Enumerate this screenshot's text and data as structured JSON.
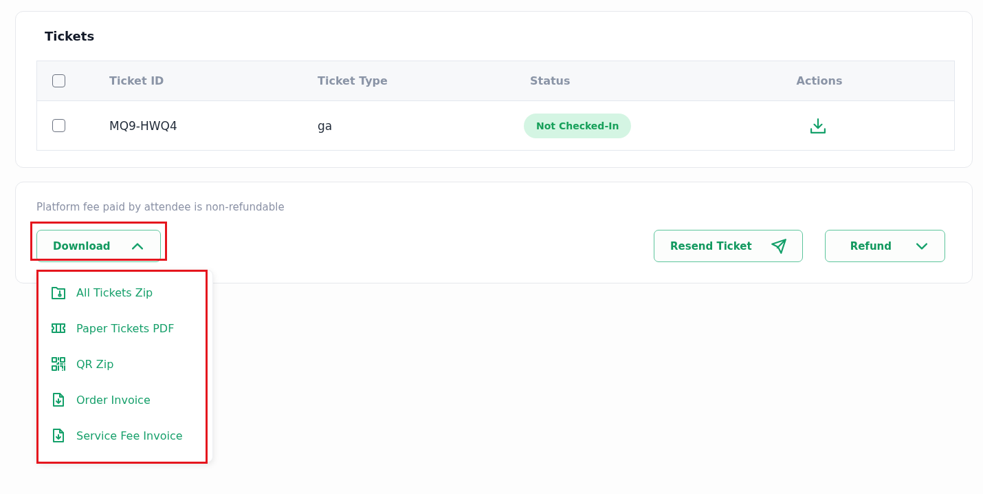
{
  "tickets_card": {
    "title": "Tickets",
    "table": {
      "select_all": {
        "checked": false
      },
      "columns": [
        "Ticket ID",
        "Ticket Type",
        "Status",
        "Actions"
      ],
      "rows": [
        {
          "checked": false,
          "ticket_id": "MQ9-HWQ4",
          "ticket_type": "ga",
          "status": "Not Checked-In"
        }
      ]
    }
  },
  "order_actions": {
    "note": "Platform fee paid by attendee is non-refundable",
    "download": {
      "label": "Download",
      "expanded": true,
      "highlighted": true,
      "menu": {
        "highlighted": true,
        "items": [
          {
            "kind": "zip",
            "label": "All Tickets Zip"
          },
          {
            "kind": "tickets",
            "label": "Paper Tickets PDF"
          },
          {
            "kind": "qr",
            "label": "QR Zip"
          },
          {
            "kind": "invoice",
            "label": "Order Invoice"
          },
          {
            "kind": "invoice",
            "label": "Service Fee Invoice"
          }
        ]
      }
    },
    "resend": {
      "label": "Resend Ticket"
    },
    "refund": {
      "label": "Refund",
      "expanded": false
    }
  }
}
